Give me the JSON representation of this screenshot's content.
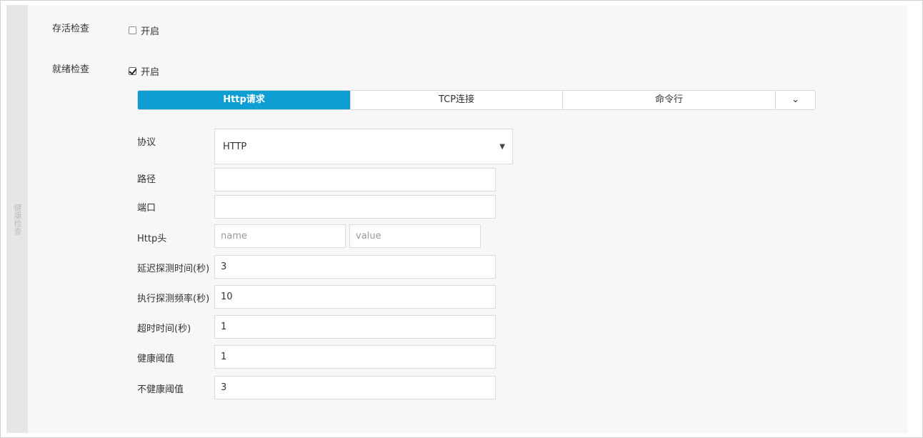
{
  "side": {
    "label": "健康检查"
  },
  "liveness": {
    "label": "存活检查",
    "checkbox_label": "开启",
    "checked": false
  },
  "readiness": {
    "label": "就绪检查",
    "checkbox_label": "开启",
    "checked": true
  },
  "tabs": [
    {
      "label": "Http请求",
      "active": true
    },
    {
      "label": "TCP连接",
      "active": false
    },
    {
      "label": "命令行",
      "active": false
    },
    {
      "label": "⌄",
      "icon": "chevron-down-icon"
    }
  ],
  "form": {
    "protocol": {
      "label": "协议",
      "value": "HTTP",
      "arrow": "▼"
    },
    "path": {
      "label": "路径",
      "value": ""
    },
    "port": {
      "label": "端口",
      "value": ""
    },
    "http_header": {
      "label": "Http头",
      "name_placeholder": "name",
      "value_placeholder": "value"
    },
    "initial_delay": {
      "label": "延迟探测时间(秒)",
      "value": "3"
    },
    "period": {
      "label": "执行探测频率(秒)",
      "value": "10"
    },
    "timeout": {
      "label": "超时时间(秒)",
      "value": "1"
    },
    "success_threshold": {
      "label": "健康阈值",
      "value": "1"
    },
    "failure_threshold": {
      "label": "不健康阈值",
      "value": "3"
    }
  },
  "colors": {
    "accent": "#0e9ed3",
    "panel_bg": "#f7f7f7",
    "strip_bg": "#e6e6e6"
  }
}
